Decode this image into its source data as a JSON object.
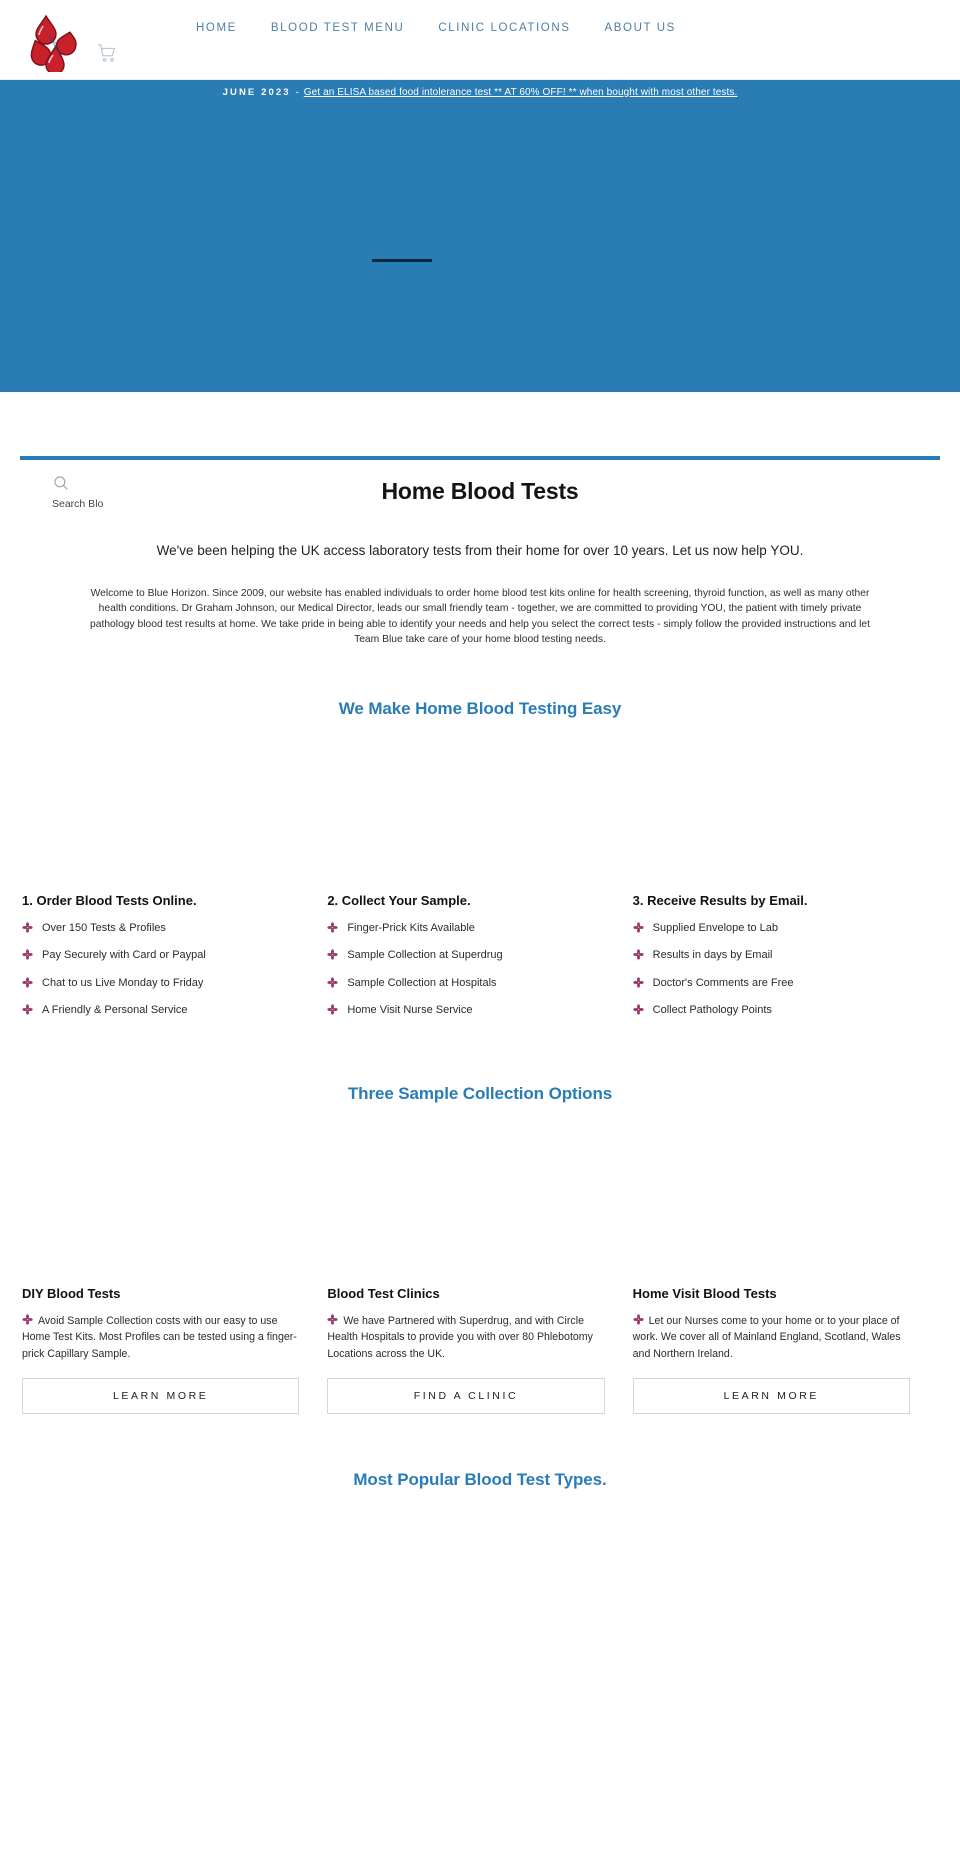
{
  "header": {
    "logo_alt": "Blue Horizon blood drop butterfly logo",
    "cart_icon": "shopping-cart-icon",
    "nav": [
      {
        "label": "HOME"
      },
      {
        "label": "BLOOD TEST MENU"
      },
      {
        "label": "CLINIC LOCATIONS"
      },
      {
        "label": "ABOUT US"
      }
    ]
  },
  "promo": {
    "date": "JUNE 2023",
    "separator": "-",
    "link_text": "Get an ELISA based food intolerance test ** AT 60% OFF! ** when bought with most other tests."
  },
  "search": {
    "icon": "search-icon",
    "label": "Search Blo",
    "placeholder": "Search Blo"
  },
  "page": {
    "title": "Home Blood Tests",
    "lead": "We've been helping the UK access laboratory tests from their home for over 10 years. Let us now help YOU.",
    "body": "Welcome to Blue Horizon. Since 2009, our website has enabled individuals to order home blood test kits online for health screening, thyroid function, as well as many other health conditions. Dr Graham Johnson, our Medical Director, leads our small friendly team - together, we are committed to providing YOU, the patient with timely private pathology blood test results at home. We take pride in being able to identify your needs and help you select the correct tests - simply follow the provided instructions and let Team Blue take care of your home blood testing needs."
  },
  "sections": {
    "easy_heading": "We Make Home Blood Testing Easy",
    "options_heading": "Three Sample Collection Options",
    "popular_heading": "Most Popular Blood Test Types."
  },
  "steps": [
    {
      "title": "1. Order Blood Tests Online.",
      "items": [
        "Over 150 Tests & Profiles",
        "Pay Securely with Card or Paypal",
        "Chat to us Live Monday to Friday",
        "A Friendly & Personal Service"
      ]
    },
    {
      "title": "2. Collect Your Sample.",
      "items": [
        "Finger-Prick Kits Available",
        "Sample Collection at Superdrug",
        "Sample Collection at Hospitals",
        "Home Visit Nurse Service"
      ]
    },
    {
      "title": "3. Receive Results by Email.",
      "items": [
        "Supplied Envelope to Lab",
        "Results in days by Email",
        "Doctor's Comments are Free",
        "Collect Pathology Points"
      ]
    }
  ],
  "collection_cards": [
    {
      "title": "DIY Blood Tests",
      "text": "Avoid Sample Collection costs with our easy to use Home Test Kits. Most Profiles can be tested using a finger-prick Capillary Sample.",
      "button": "LEARN MORE"
    },
    {
      "title": "Blood Test Clinics",
      "text": "We have Partnered with Superdrug, and with Circle Health Hospitals to provide you with over 80 Phlebotomy Locations across the UK.",
      "button": "FIND A CLINIC"
    },
    {
      "title": "Home Visit Blood Tests",
      "text": "Let our Nurses come to your home or to your place of work. We cover all of Mainland England, Scotland, Wales and Northern Ireland.",
      "button": "LEARN MORE"
    }
  ],
  "colors": {
    "brand_blue": "#2a7cb5",
    "nav_blue": "#4b7fa6",
    "bullet_maroon": "#9b3a6b",
    "logo_red": "#c9202b",
    "hero_rule": "#0d2a3d"
  }
}
